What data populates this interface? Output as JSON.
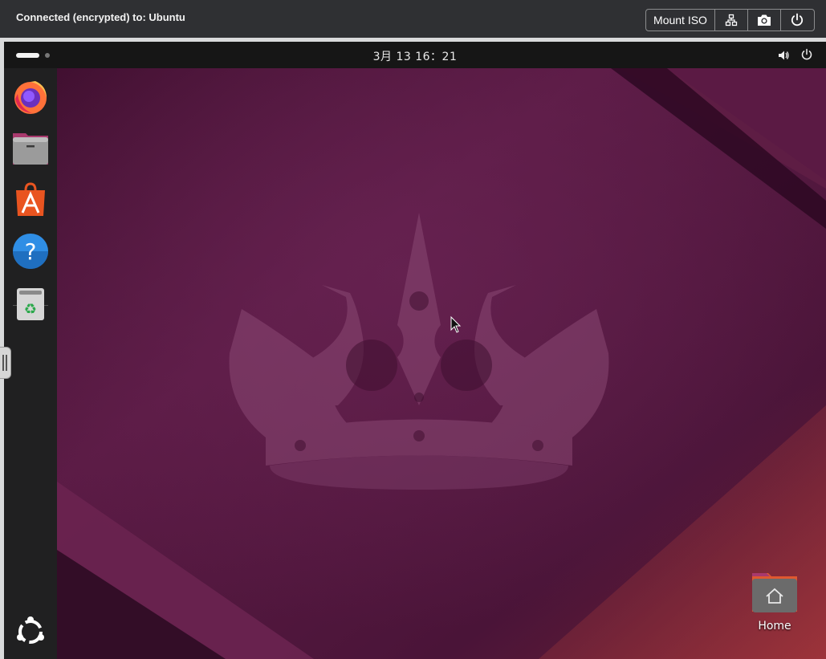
{
  "session": {
    "title": "Connected (encrypted) to: Ubuntu",
    "mount_label": "Mount ISO",
    "icons": [
      "network-icon",
      "camera-icon",
      "power-icon"
    ]
  },
  "topbar": {
    "clock": "3月 13  16：21",
    "tray_icons": [
      "volume-icon",
      "power-icon"
    ]
  },
  "dock": {
    "items": [
      {
        "name": "Firefox",
        "icon": "firefox-icon"
      },
      {
        "name": "Files",
        "icon": "files-icon"
      },
      {
        "name": "App Center",
        "icon": "app-center-icon"
      },
      {
        "name": "Help",
        "icon": "help-icon"
      },
      {
        "name": "Trash",
        "icon": "trash-icon"
      }
    ],
    "show_apps_icon": "ubuntu-logo-icon"
  },
  "desktop": {
    "home_label": "Home",
    "wallpaper": "ubuntu-noble-numbat-crown",
    "colors": {
      "bg_dark": "#2b0a21",
      "bg_mid": "#5a1b42",
      "accent": "#e95420"
    }
  }
}
